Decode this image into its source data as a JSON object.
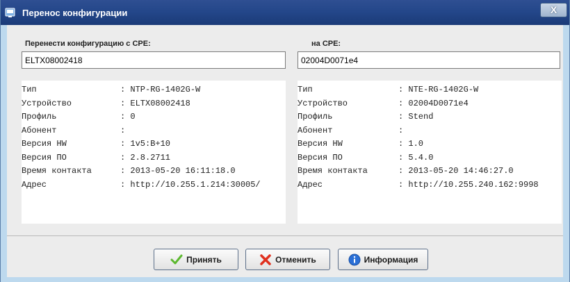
{
  "window": {
    "title": "Перенос конфигурации",
    "close_label": "X"
  },
  "source": {
    "label": "Перенести конфигурацию с CPE:",
    "value": "ELTX08002418",
    "rows": [
      {
        "key": "Тип",
        "value": ": NTP-RG-1402G-W"
      },
      {
        "key": "Устройство",
        "value": ": ELTX08002418"
      },
      {
        "key": "Профиль",
        "value": ": 0"
      },
      {
        "key": "Абонент",
        "value": ":"
      },
      {
        "key": "Версия HW",
        "value": ": 1v5:B+10"
      },
      {
        "key": "Версия ПО",
        "value": ": 2.8.2711"
      },
      {
        "key": "Время контакта",
        "value": ": 2013-05-20 16:11:18.0"
      },
      {
        "key": "Адрес",
        "value": ": http://10.255.1.214:30005/"
      }
    ]
  },
  "target": {
    "label": "на CPE:",
    "value": "02004D0071e4",
    "rows": [
      {
        "key": "Тип",
        "value": ": NTE-RG-1402G-W"
      },
      {
        "key": "Устройство",
        "value": ": 02004D0071e4"
      },
      {
        "key": "Профиль",
        "value": ": Stend"
      },
      {
        "key": "Абонент",
        "value": ":"
      },
      {
        "key": "Версия HW",
        "value": ": 1.0"
      },
      {
        "key": "Версия ПО",
        "value": ": 5.4.0"
      },
      {
        "key": "Время контакта",
        "value": ": 2013-05-20 14:46:27.0"
      },
      {
        "key": "Адрес",
        "value": ": http://10.255.240.162:9998"
      }
    ]
  },
  "buttons": {
    "accept": {
      "label": "Принять",
      "icon": "checkmark-icon"
    },
    "cancel": {
      "label": "Отменить",
      "icon": "cross-icon"
    },
    "info": {
      "label": "Информация",
      "icon": "info-icon"
    }
  },
  "colors": {
    "accent_green": "#5cb82e",
    "cancel_red": "#e0301e",
    "info_blue": "#2a6fd6",
    "title_blue": "#24478a"
  }
}
